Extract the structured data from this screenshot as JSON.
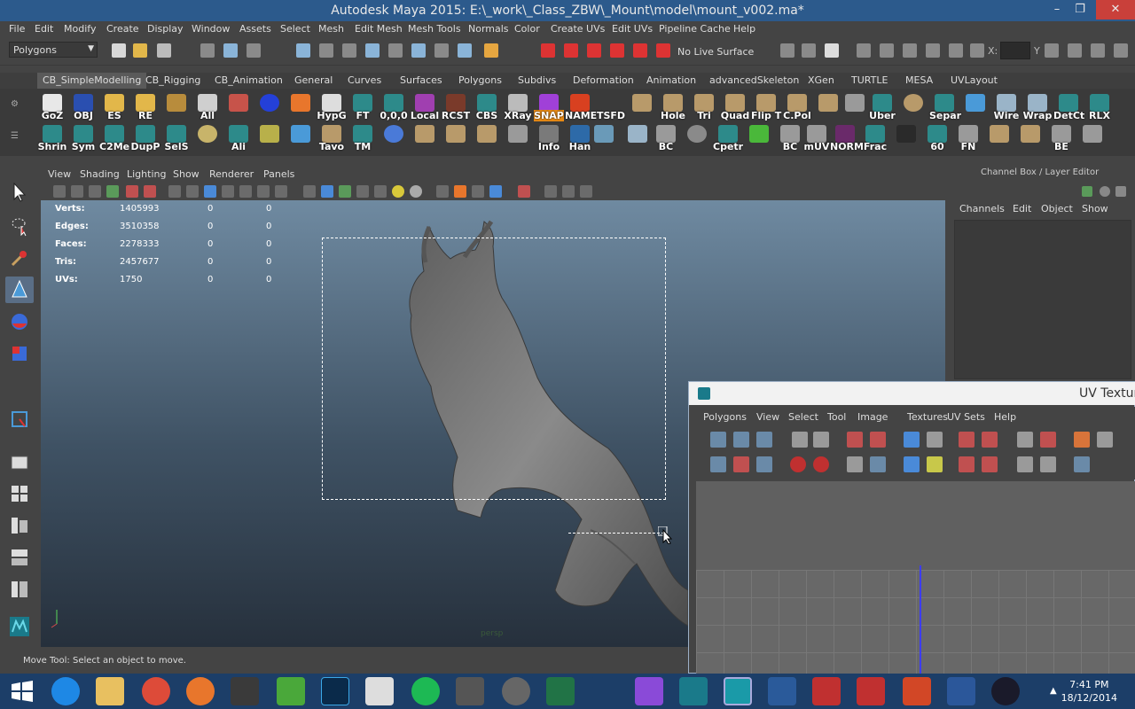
{
  "window": {
    "title": "Autodesk Maya 2015: E:\\_work\\_Class_ZBW\\_Mount\\model\\mount_v002.ma*",
    "minimize": "–",
    "maximize": "❐",
    "close": "✕"
  },
  "menubar": [
    "File",
    "Edit",
    "Modify",
    "Create",
    "Display",
    "Window",
    "Assets",
    "Select",
    "Mesh",
    "Edit Mesh",
    "Mesh Tools",
    "Normals",
    "Color",
    "Create UVs",
    "Edit UVs",
    "Pipeline Cache",
    "Help"
  ],
  "statusline": {
    "mode": "Polygons",
    "live_surface": "No Live Surface",
    "x_label": "X:",
    "y_label": "Y"
  },
  "shelf_tabs": [
    "CB_SimpleModelling",
    "CB_Rigging",
    "CB_Animation",
    "General",
    "Curves",
    "Surfaces",
    "Polygons",
    "Subdivs",
    "Deformation",
    "Animation",
    "advancedSkeleton",
    "XGen",
    "TURTLE",
    "MESA",
    "UVLayout"
  ],
  "shelf_row1": [
    "GoZ",
    "OBJ",
    "ES",
    "RE",
    "",
    "All",
    "",
    "",
    "HypG",
    "FT",
    "0,0,0",
    "Local",
    "RCST",
    "CBS",
    "XRay",
    "SNAP",
    "NAME",
    "TSFD",
    "",
    "Hole",
    "Tri",
    "Quad",
    "Flip T",
    "C.Pol",
    "",
    "",
    "Uber",
    "",
    "Separ",
    "",
    "Wire",
    "Wrap",
    "DetCt",
    "RLX"
  ],
  "shelf_row2": [
    "Shrin",
    "Sym",
    "C2Me",
    "DupP",
    "SelS",
    "",
    "Ali",
    "",
    "",
    "Tavo",
    "TM",
    "",
    "",
    "",
    "",
    "",
    "Info",
    "Han",
    "",
    "",
    "BC",
    "",
    "Cpetr",
    "",
    "BC",
    "mUV",
    "NORM",
    "Frac",
    "",
    "60",
    "FN",
    "",
    "",
    "BE",
    ""
  ],
  "shelf_row2_extra": {
    "x_label": "X"
  },
  "viewport": {
    "menus": [
      "View",
      "Shading",
      "Lighting",
      "Show",
      "Renderer",
      "Panels"
    ],
    "hud": [
      {
        "label": "Verts:",
        "v1": "1405993",
        "v2": "0",
        "v3": "0"
      },
      {
        "label": "Edges:",
        "v1": "3510358",
        "v2": "0",
        "v3": "0"
      },
      {
        "label": "Faces:",
        "v1": "2278333",
        "v2": "0",
        "v3": "0"
      },
      {
        "label": "Tris:",
        "v1": "2457677",
        "v2": "0",
        "v3": "0"
      },
      {
        "label": "UVs:",
        "v1": "1750",
        "v2": "0",
        "v3": "0"
      }
    ],
    "axis_labels": {
      "y": "y",
      "z": "z",
      "x": "x"
    }
  },
  "channelbox": {
    "title": "Channel Box / Layer Editor",
    "menus": [
      "Channels",
      "Edit",
      "Object",
      "Show"
    ]
  },
  "uv_editor": {
    "title": "UV Textur",
    "menus": [
      "Polygons",
      "View",
      "Select",
      "Tool",
      "Image",
      "Textures",
      "UV Sets",
      "Help"
    ]
  },
  "helpline": "Move Tool: Select an object to move.",
  "clock": {
    "time": "7:41 PM",
    "date": "18/12/2014"
  },
  "colors": {
    "titlebar": "#2c5a8c",
    "taskbar": "#1c3e68",
    "viewport_top": "#6f8aa1",
    "viewport_bottom": "#26303c",
    "uv_axis": "#3c3cff"
  }
}
